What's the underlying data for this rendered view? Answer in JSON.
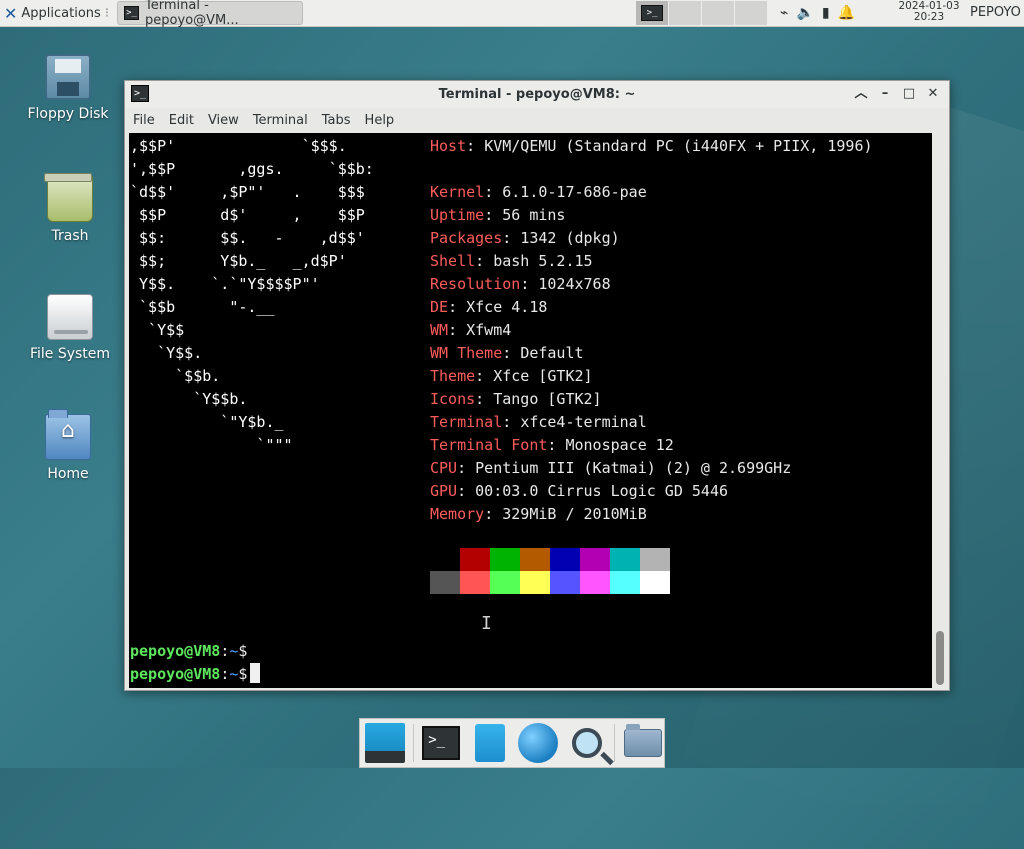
{
  "top_panel": {
    "applications_label": "Applications",
    "task_title": "Terminal - pepoyo@VM...",
    "clock_date": "2024-01-03",
    "clock_time": "20:23",
    "user": "PEPOYO"
  },
  "desktop_icons": [
    {
      "label": "Floppy Disk"
    },
    {
      "label": "Trash"
    },
    {
      "label": "File System"
    },
    {
      "label": "Home"
    }
  ],
  "window": {
    "title": "Terminal - pepoyo@VM8: ~",
    "menu": [
      "File",
      "Edit",
      "View",
      "Terminal",
      "Tabs",
      "Help"
    ]
  },
  "logo_lines": [
    ",$$P'              `$$$.",
    "',$$P       ,ggs.     `$$b:",
    "`d$$'     ,$P\"'   .    $$$",
    " $$P      d$'     ,    $$P",
    " $$:      $$.   -    ,d$$'",
    " $$;      Y$b._   _,d$P'",
    " Y$$.    `.`\"Y$$$$P\"'",
    " `$$b      \"-.__",
    "  `Y$$",
    "   `Y$$.",
    "     `$$b.",
    "       `Y$$b.",
    "          `\"Y$b._",
    "              `\"\"\""
  ],
  "sysinfo": {
    "host": {
      "key": "Host",
      "value": "KVM/QEMU (Standard PC (i440FX + PIIX, 1996)"
    },
    "items": [
      {
        "key": "Kernel",
        "value": "6.1.0-17-686-pae"
      },
      {
        "key": "Uptime",
        "value": "56 mins"
      },
      {
        "key": "Packages",
        "value": "1342 (dpkg)"
      },
      {
        "key": "Shell",
        "value": "bash 5.2.15"
      },
      {
        "key": "Resolution",
        "value": "1024x768"
      },
      {
        "key": "DE",
        "value": "Xfce 4.18"
      },
      {
        "key": "WM",
        "value": "Xfwm4"
      },
      {
        "key": "WM Theme",
        "value": "Default"
      },
      {
        "key": "Theme",
        "value": "Xfce [GTK2]"
      },
      {
        "key": "Icons",
        "value": "Tango [GTK2]"
      },
      {
        "key": "Terminal",
        "value": "xfce4-terminal"
      },
      {
        "key": "Terminal Font",
        "value": "Monospace 12"
      },
      {
        "key": "CPU",
        "value": "Pentium III (Katmai) (2) @ 2.699GHz"
      },
      {
        "key": "GPU",
        "value": "00:03.0 Cirrus Logic GD 5446"
      },
      {
        "key": "Memory",
        "value": "329MiB / 2010MiB"
      }
    ]
  },
  "palette": {
    "row1": [
      "#000000",
      "#b30000",
      "#00b300",
      "#b35900",
      "#0000b3",
      "#b300b3",
      "#00b3b3",
      "#b3b3b3"
    ],
    "row2": [
      "#555555",
      "#ff5555",
      "#55ff55",
      "#ffff55",
      "#5555ff",
      "#ff55ff",
      "#55ffff",
      "#ffffff"
    ]
  },
  "prompts": [
    {
      "user": "pepoyo@VM8",
      "sep": ":",
      "path": "~",
      "sym": "$"
    },
    {
      "user": "pepoyo@VM8",
      "sep": ":",
      "path": "~",
      "sym": "$"
    }
  ]
}
